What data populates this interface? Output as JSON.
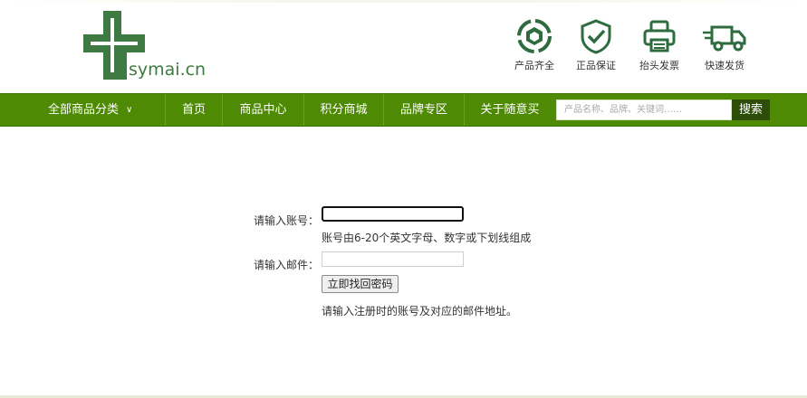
{
  "logo": {
    "text": "symai.cn"
  },
  "features": [
    {
      "label": "产品齐全",
      "icon": "recycle-icon"
    },
    {
      "label": "正品保证",
      "icon": "shield-check-icon"
    },
    {
      "label": "抬头发票",
      "icon": "printer-icon"
    },
    {
      "label": "快速发货",
      "icon": "delivery-truck-icon"
    }
  ],
  "nav": {
    "category": "全部商品分类",
    "items": [
      "首页",
      "商品中心",
      "积分商城",
      "品牌专区",
      "关于随意买"
    ],
    "search_placeholder": "产品名称、品牌、关键词……",
    "search_button": "搜索"
  },
  "form": {
    "account_label": "请输入账号：",
    "account_value": "",
    "account_hint": "账号由6-20个英文字母、数字或下划线组成",
    "email_label": "请输入邮件：",
    "email_value": "",
    "submit_label": "立即找回密码",
    "note": "请输入注册时的账号及对应的邮件地址。"
  },
  "colors": {
    "nav_green": "#4e8a04",
    "logo_green": "#3f7a42",
    "search_button": "#2d4d09",
    "icon_green": "#2e6b3f"
  }
}
